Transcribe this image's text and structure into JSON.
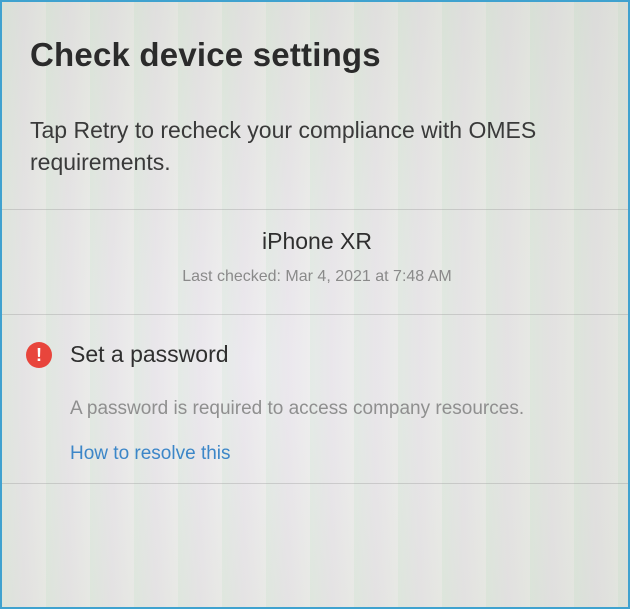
{
  "page": {
    "title": "Check device settings",
    "description": "Tap Retry to recheck your compliance with OMES requirements."
  },
  "device": {
    "name": "iPhone XR",
    "last_checked": "Last checked: Mar 4, 2021 at 7:48 AM"
  },
  "issues": [
    {
      "icon": "exclamation-icon",
      "icon_glyph": "!",
      "icon_color": "#e8453c",
      "title": "Set a password",
      "description": "A password is required to access company resources.",
      "link_label": "How to resolve this"
    }
  ],
  "colors": {
    "link": "#3c86c8",
    "error": "#e8453c",
    "frame_border": "#3fa2cf"
  }
}
